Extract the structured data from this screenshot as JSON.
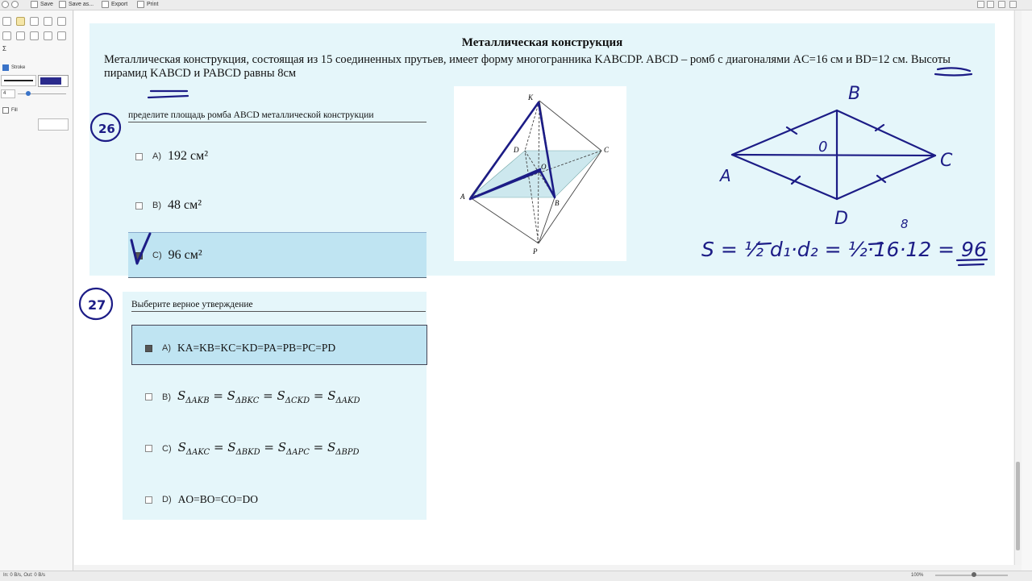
{
  "toolbar": {
    "save_label": "Save",
    "save_as_label": "Save as...",
    "export_label": "Export",
    "print_label": "Print"
  },
  "left_panel": {
    "stroke_label": "Stroke",
    "fill_label": "Fill",
    "stroke_width": "4",
    "stroke_color": "#2a2a8c",
    "sigma": "Σ"
  },
  "status": {
    "network": "In: 0 B/s, Out: 0 B/s",
    "zoom": "100%"
  },
  "document": {
    "title": "Металлическая конструкция",
    "text": "Металлическая конструкция, состоящая из 15 соединенных прутьев, имеет форму многогранника KABCDP. ABCD – ромб с диагоналями AC=16 см и BD=12 см. Высоты пирамид KABCD и PABCD равны 8см"
  },
  "q26": {
    "number": "26",
    "question": "пределите площадь ромба ABCD металлической конструкции",
    "options": [
      {
        "letter": "A)",
        "text": "192 см²",
        "selected": false
      },
      {
        "letter": "B)",
        "text": "48 см²",
        "selected": false
      },
      {
        "letter": "C)",
        "text": "96 см²",
        "selected": true
      }
    ]
  },
  "q27": {
    "number": "27",
    "question": "Выберите верное утверждение",
    "options": [
      {
        "letter": "A)",
        "text": "KA=KB=KC=KD=PA=PB=PC=PD",
        "selected": true
      },
      {
        "letter": "B)",
        "subs": [
          "ΔAKB",
          "ΔBKC",
          "ΔCKD",
          "ΔAKD"
        ],
        "selected": false
      },
      {
        "letter": "C)",
        "subs": [
          "ΔAKC",
          "ΔBKD",
          "ΔAPC",
          "ΔBPD"
        ],
        "selected": false
      },
      {
        "letter": "D)",
        "text": "AO=BO=CO=DO",
        "selected": false
      }
    ]
  },
  "figure": {
    "labels": {
      "K": "K",
      "A": "A",
      "B": "B",
      "C": "C",
      "D": "D",
      "P": "P",
      "O": "O"
    }
  },
  "handwriting": {
    "B": "B",
    "A": "A",
    "C": "C",
    "D": "D",
    "O": "0",
    "eight": "8",
    "formula": "S = ½ d₁·d₂ = ½·16·12 = 96",
    "result": "96"
  },
  "colors": {
    "ink": "#1c1c86",
    "panel_bg": "#e5f6fa",
    "selected_bg": "#bfe4f2"
  }
}
